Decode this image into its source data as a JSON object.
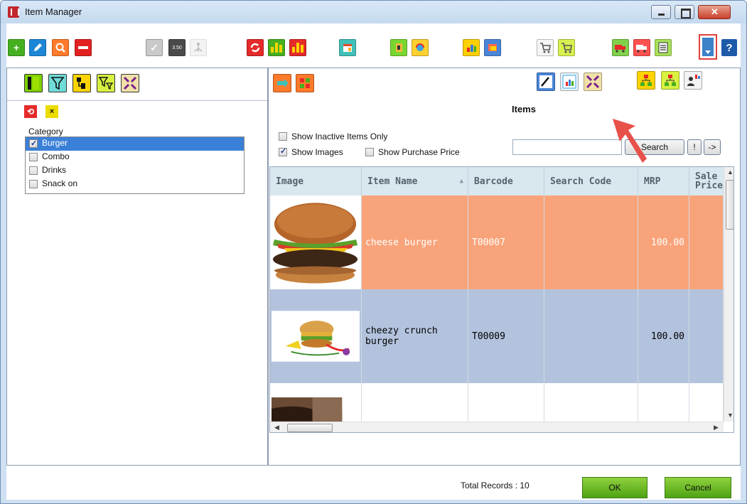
{
  "window": {
    "title": "Item Manager",
    "controls": {
      "minimize": "minimize",
      "maximize": "maximize",
      "close": "close"
    }
  },
  "toolbar": {
    "help_label": "?",
    "small_stamp": "3.50",
    "icons": [
      {
        "name": "add-item-icon",
        "color": "#46b020",
        "glyph": "+"
      },
      {
        "name": "edit-item-icon",
        "color": "#1c87d6",
        "glyph": "✎"
      },
      {
        "name": "search-item-icon",
        "color": "#ff7a2b",
        "glyph": "🔍"
      },
      {
        "name": "delete-item-icon",
        "color": "#e32020",
        "glyph": "—"
      },
      {
        "name": "approve-icon",
        "color": "#c9c9c9",
        "glyph": "✓"
      },
      {
        "name": "price-tag-icon",
        "color": "#4a4a4a",
        "glyph": ""
      },
      {
        "name": "hierarchy-icon",
        "color": "#dddddd",
        "glyph": "⚲"
      },
      {
        "name": "refresh-icon",
        "color": "#e52a2a",
        "glyph": "⟲"
      },
      {
        "name": "bar-chart-green-icon",
        "color": "#46b020",
        "glyph": ""
      },
      {
        "name": "bar-chart-red-icon",
        "color": "#e52a2a",
        "glyph": ""
      },
      {
        "name": "calendar-icon",
        "color": "#40c0b8",
        "glyph": ""
      },
      {
        "name": "document-icon",
        "color": "#78d630",
        "glyph": ""
      },
      {
        "name": "sync-icon",
        "color": "#ffd030",
        "glyph": ""
      },
      {
        "name": "report-icon",
        "color": "#ffcf00",
        "glyph": ""
      },
      {
        "name": "layers-icon",
        "color": "#4a86d8",
        "glyph": ""
      },
      {
        "name": "cart-icon",
        "color": "#f2f2f2",
        "glyph": ""
      },
      {
        "name": "cart-add-icon",
        "color": "#d8f050",
        "glyph": ""
      },
      {
        "name": "truck-icon",
        "color": "#7fd24a",
        "glyph": ""
      },
      {
        "name": "truck-return-icon",
        "color": "#ff5050",
        "glyph": ""
      },
      {
        "name": "list-icon",
        "color": "#a7e05a",
        "glyph": ""
      }
    ]
  },
  "left_panel": {
    "tools": [
      {
        "name": "columns-icon",
        "color": "#7fd000"
      },
      {
        "name": "filter-icon",
        "color": "#70dcd8"
      },
      {
        "name": "tree-icon",
        "color": "#ffd400"
      },
      {
        "name": "filter-add-icon",
        "color": "#d8f040"
      },
      {
        "name": "collapse-icon",
        "color": "#f0e0a8"
      }
    ],
    "reset_label": "⟲",
    "clear_label": "×",
    "category_label": "Category",
    "categories": [
      {
        "label": "Burger",
        "checked": true,
        "selected": true
      },
      {
        "label": "Combo",
        "checked": false,
        "selected": false
      },
      {
        "label": "Drinks",
        "checked": false,
        "selected": false
      },
      {
        "label": "Snack on",
        "checked": false,
        "selected": false
      }
    ]
  },
  "right_panel": {
    "title": "Items",
    "show_inactive_label": "Show Inactive Items Only",
    "show_images_label": "Show Images",
    "show_purchase_price_label": "Show Purchase Price",
    "show_inactive_checked": false,
    "show_images_checked": true,
    "show_purchase_price_checked": false,
    "search_value": "",
    "search_button": "Search",
    "exclaim_button": "!",
    "arrow_button": "->",
    "columns": [
      "Image",
      "Item Name",
      "Barcode",
      "Search Code",
      "MRP",
      "Sale Price"
    ],
    "rows": [
      {
        "image": "cheese-burger-image",
        "item_name": "cheese burger",
        "barcode": "T00007",
        "search_code": "",
        "mrp": "100.00",
        "sale_price": "",
        "highlight": "#f9a37a"
      },
      {
        "image": "cheezy-crunch-burger-image",
        "item_name": "cheezy crunch burger",
        "barcode": "T00009",
        "search_code": "",
        "mrp": "100.00",
        "sale_price": "",
        "highlight": "#b3c3dd"
      },
      {
        "image": "third-item-image",
        "item_name": "",
        "barcode": "",
        "search_code": "",
        "mrp": "",
        "sale_price": "",
        "highlight": "#ffffff"
      }
    ],
    "total_records": "Total Records : 10"
  },
  "footer": {
    "ok_label": "OK",
    "cancel_label": "Cancel"
  }
}
